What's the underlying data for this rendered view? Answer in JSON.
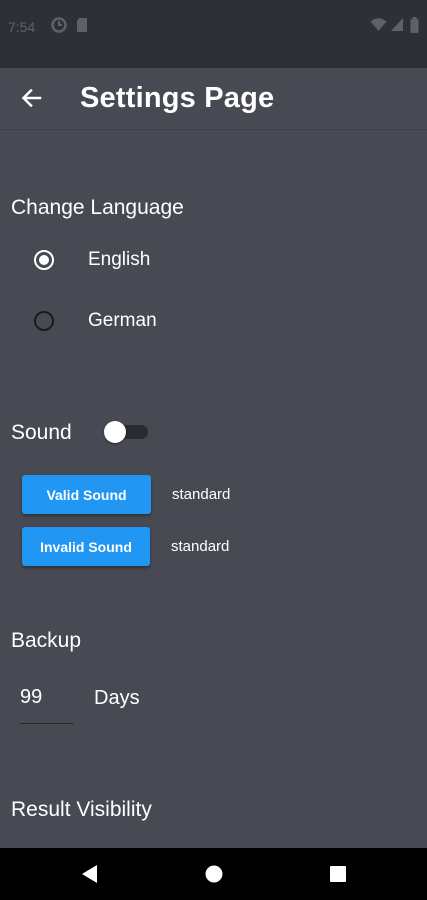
{
  "status_bar": {
    "time": "7:54",
    "icons": [
      "data-saver-icon",
      "sim-card-icon",
      "wifi-icon",
      "signal-icon",
      "battery-icon"
    ]
  },
  "app_bar": {
    "back_icon": "arrow-back-icon",
    "title": "Settings Page"
  },
  "language": {
    "title": "Change Language",
    "options": [
      {
        "label": "English",
        "selected": true
      },
      {
        "label": "German",
        "selected": false
      }
    ]
  },
  "sound": {
    "title": "Sound",
    "enabled": false,
    "valid_button": "Valid Sound",
    "valid_value": "standard",
    "invalid_button": "Invalid Sound",
    "invalid_value": "standard"
  },
  "backup": {
    "title": "Backup",
    "days_value": "99",
    "days_label": "Days"
  },
  "result_visibility": {
    "title": "Result Visibility"
  },
  "nav_bar": {
    "icons": [
      "back-triangle-icon",
      "home-circle-icon",
      "recents-square-icon"
    ]
  },
  "colors": {
    "background": "#474953",
    "status_bar": "#2f3037",
    "accent_button": "#2196f3",
    "nav_bar": "#000000"
  }
}
